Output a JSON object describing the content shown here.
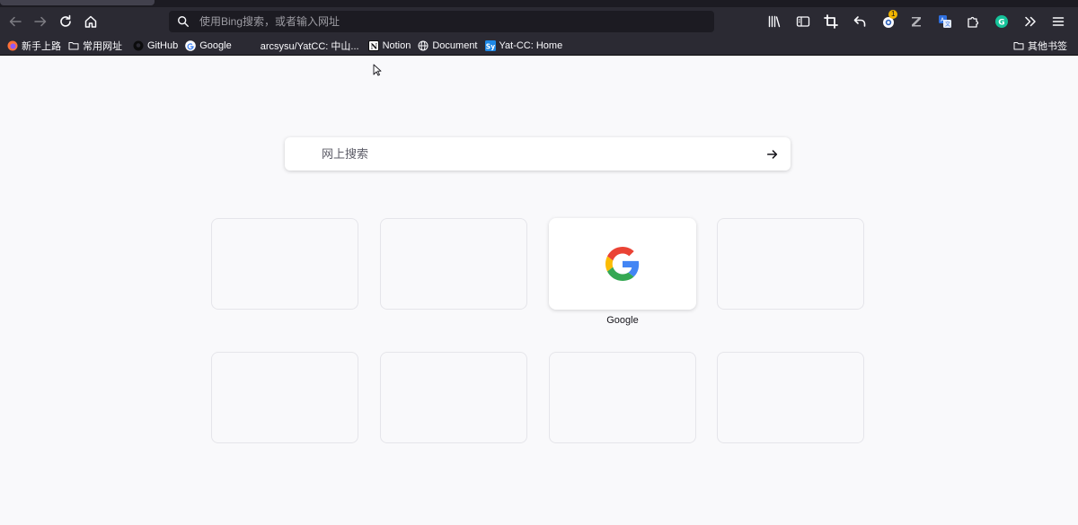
{
  "toolbar": {
    "url_placeholder": "使用Bing搜索，或者输入网址",
    "extension_badge": "1"
  },
  "bookmarks": [
    {
      "label": "新手上路",
      "icon": "firefox-icon"
    },
    {
      "label": "常用网址",
      "icon": "folder-icon"
    },
    {
      "label": "GitHub",
      "icon": "github-icon"
    },
    {
      "label": "Google",
      "icon": "google-icon"
    },
    {
      "label": "arcsysu/YatCC: 中山...",
      "icon": "page-icon"
    },
    {
      "label": "Notion",
      "icon": "notion-icon"
    },
    {
      "label": "Document",
      "icon": "globe-icon"
    },
    {
      "label": "Yat-CC: Home",
      "icon": "sy-icon"
    }
  ],
  "other_bookmarks": "其他书签",
  "newtab": {
    "search_placeholder": "网上搜索",
    "tiles": [
      {
        "label": "",
        "filled": false
      },
      {
        "label": "",
        "filled": false
      },
      {
        "label": "Google",
        "filled": true,
        "icon": "google-logo-icon"
      },
      {
        "label": "",
        "filled": false
      },
      {
        "label": "",
        "filled": false
      },
      {
        "label": "",
        "filled": false
      },
      {
        "label": "",
        "filled": false
      },
      {
        "label": "",
        "filled": false
      }
    ]
  },
  "colors": {
    "toolbar_bg": "#2b2a33",
    "urlbar_bg": "#1c1b22",
    "page_bg": "#f9f9fb",
    "grammarly_green": "#15c39a"
  }
}
